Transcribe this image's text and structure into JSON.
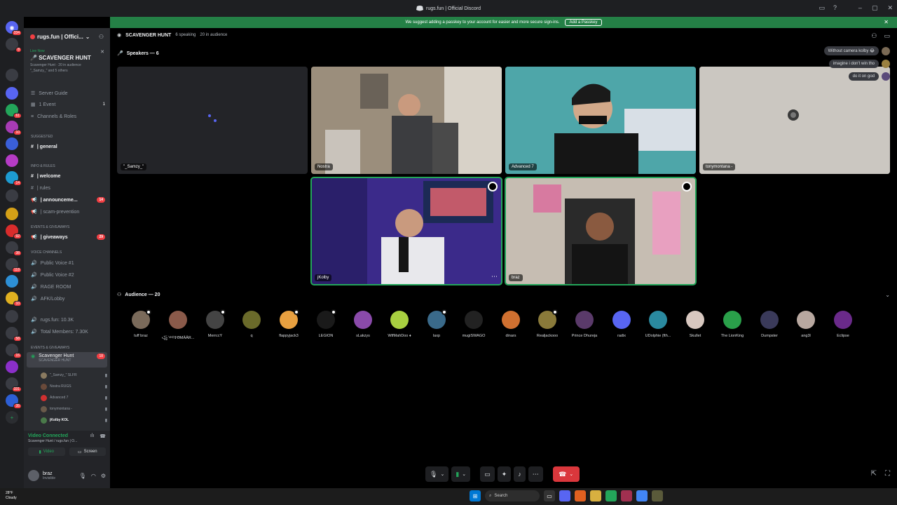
{
  "window": {
    "title": "rugs.fun | Official Discord"
  },
  "banner": {
    "text": "We suggest adding a passkey to your account for easier and more secure sign-ins.",
    "button": "Add a Passkey"
  },
  "server_rail": {
    "badges": [
      "334",
      "8",
      "61",
      "10",
      "14",
      "92",
      "38",
      "118",
      "33",
      "58",
      "15",
      "331",
      "35"
    ]
  },
  "server": {
    "name": "rugs.fun | Offici..."
  },
  "stage_card": {
    "live": "Live Now",
    "name": "SCAVENGER HUNT",
    "meta": "Scavenger Hunt · 20 in audience",
    "speakers_meta": "\"_Samzy_\" and 5 others"
  },
  "nav": {
    "server_guide": "Server Guide",
    "events": "1 Event",
    "events_count": "1",
    "channels_roles": "Channels & Roles",
    "suggested": "Suggested",
    "general": "| general",
    "cat_info": "INFO & RULES",
    "welcome": "| welcome",
    "rules": "| rules",
    "announcements": "| announceme...",
    "announcements_count": "14",
    "scam": "| scam-prevention",
    "cat_events": "EVENTS & GIVEAWAYS",
    "giveaways": "| giveaways",
    "giveaways_count": "29",
    "cat_voice": "VOICE CHANNELS",
    "pv1": "Public Voice #1",
    "pv2": "Public Voice #2",
    "rage": "RAGE ROOM",
    "afk": "AFK/Lobby",
    "rugs_stat": "rugs.fun: 10.3K",
    "members_stat": "Total Members: 7.30K",
    "cat_events2": "EVENTS & GIVEAWAYS",
    "scav": "Scavenger Hunt",
    "scav_count": "18",
    "scav_sub": "SCAVENGER HUNT"
  },
  "vc_users": [
    "\"_Samzy_\" SLFR",
    "Nostra RUGS",
    "Advanced 7",
    "tonymontana -",
    "jKolby KOL"
  ],
  "voice_panel": {
    "status": "Video Connected",
    "sub": "Scavenger Hunt / rugs.fun | O...",
    "video": "Video",
    "screen": "Screen"
  },
  "user_panel": {
    "name": "braz",
    "status": "Invisible"
  },
  "stage": {
    "title": "SCAVENGER HUNT",
    "speaking": "6 speaking",
    "audience": "20 in audience",
    "speakers_label": "Speakers — 6",
    "audience_label": "Audience — 20"
  },
  "speakers": [
    {
      "name": "\"_Samzy_\""
    },
    {
      "name": "Nostra"
    },
    {
      "name": "Advanced 7"
    },
    {
      "name": "tonymontana -"
    },
    {
      "name": "jKolby"
    },
    {
      "name": "braz"
    }
  ],
  "chat": [
    "Without camera kolby 😂",
    "imagine i don't win tho",
    "do it on god"
  ],
  "audience": [
    "tuff braz",
    "꧁༺✞ϴMÄÄR...",
    "MerrccY",
    "q",
    "flappyjack3",
    "LEGION",
    "sLakzys",
    "WtfMahDoo ♦",
    "laxp",
    "mugiSWAGO",
    "dinars",
    "Realjackooo",
    "Prince Dhureja",
    "radix",
    "UDolphie (fth...",
    "Skullet",
    "The LionKing",
    "Dumpster",
    "ang3l",
    "Eclipse"
  ],
  "taskbar": {
    "temp": "28°F",
    "weather": "Cloudy",
    "search": "Search"
  },
  "colors": {
    "accent_green": "#23a55a",
    "banner_green": "#248046",
    "danger": "#da373c",
    "blurple": "#5865f2"
  }
}
